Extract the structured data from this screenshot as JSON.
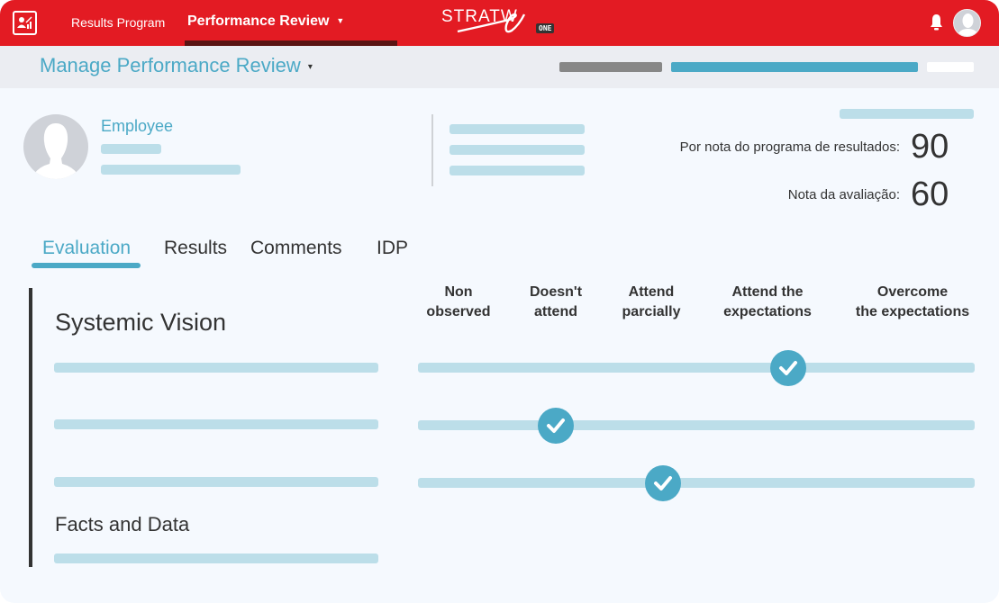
{
  "topbar": {
    "app_icon": "performance-chart-icon",
    "nav": [
      {
        "label": "Results Program",
        "active": false
      },
      {
        "label": "Performance Review",
        "active": true,
        "has_dropdown": true
      }
    ],
    "logo": {
      "text": "STRATWS",
      "badge": "ONE"
    },
    "notification_icon": "bell-icon",
    "user_avatar": "user-avatar-icon",
    "colors": {
      "bar": "#e31b23",
      "active_underline": "#5a1414"
    }
  },
  "subheader": {
    "title": "Manage Performance Review",
    "caret": "▾"
  },
  "employee": {
    "label": "Employee"
  },
  "scores": [
    {
      "label": "Por nota do programa de resultados:",
      "value": "90"
    },
    {
      "label": "Nota da avaliação:",
      "value": "60"
    }
  ],
  "tabs": [
    {
      "label": "Evaluation",
      "active": true
    },
    {
      "label": "Results",
      "active": false
    },
    {
      "label": "Comments",
      "active": false
    },
    {
      "label": "IDP",
      "active": false
    }
  ],
  "evaluation": {
    "scale": [
      {
        "line1": "Non",
        "line2": "observed"
      },
      {
        "line1": "Doesn't",
        "line2": "attend"
      },
      {
        "line1": "Attend",
        "line2": "parcially"
      },
      {
        "line1": "Attend the",
        "line2": "expectations"
      },
      {
        "line1": "Overcome",
        "line2": "the expectations"
      }
    ],
    "sections": [
      {
        "title": "Systemic Vision"
      },
      {
        "title": "Facts and Data"
      }
    ],
    "ratings": [
      {
        "selected_index": 3,
        "selected_label": "Attend the expectations"
      },
      {
        "selected_index": 1,
        "selected_label": "Doesn't attend"
      },
      {
        "selected_index": 2,
        "selected_label": "Attend parcially"
      }
    ],
    "accent": "#4ba9c6"
  }
}
